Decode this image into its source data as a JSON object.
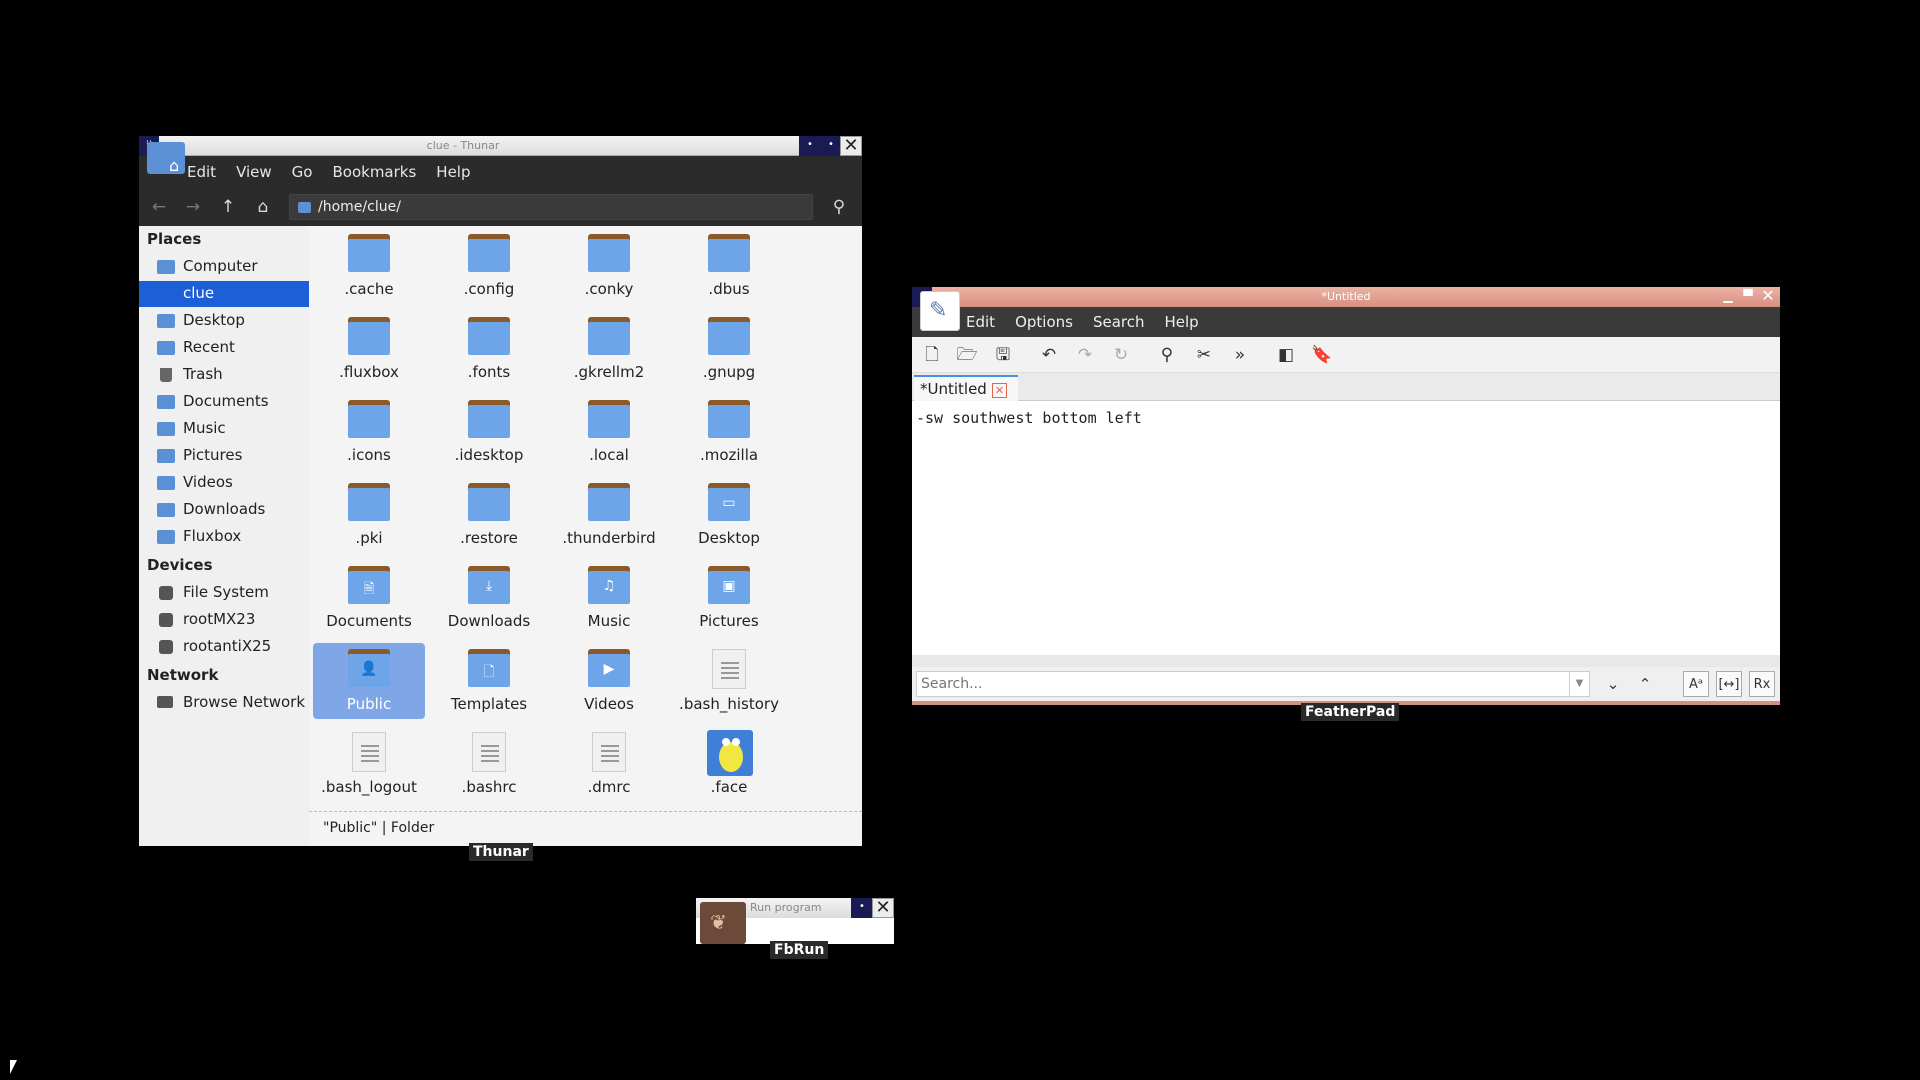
{
  "thunar": {
    "title": "clue - Thunar",
    "menu": [
      "Edit",
      "View",
      "Go",
      "Bookmarks",
      "Help"
    ],
    "location": "/home/clue/",
    "sidebar": {
      "places_header": "Places",
      "places": [
        "Computer",
        "clue",
        "Desktop",
        "Recent",
        "Trash",
        "Documents",
        "Music",
        "Pictures",
        "Videos",
        "Downloads",
        "Fluxbox"
      ],
      "selected": "clue",
      "devices_header": "Devices",
      "devices": [
        "File System",
        "rootMX23",
        "rootantiX25"
      ],
      "network_header": "Network",
      "network": [
        "Browse Network"
      ]
    },
    "files": [
      ".cache",
      ".config",
      ".conky",
      ".dbus",
      ".fluxbox",
      ".fonts",
      ".gkrellm2",
      ".gnupg",
      ".icons",
      ".idesktop",
      ".local",
      ".mozilla",
      ".pki",
      ".restore",
      ".thunderbird",
      "Desktop",
      "Documents",
      "Downloads",
      "Music",
      "Pictures",
      "Public",
      "Templates",
      "Videos",
      ".bash_history",
      ".bash_logout",
      ".bashrc",
      ".dmrc",
      ".face"
    ],
    "selected_file": "Public",
    "status": "\"Public\"  |  Folder",
    "taskbar_label": "Thunar"
  },
  "featherpad": {
    "title": "*Untitled",
    "menu": [
      "Edit",
      "Options",
      "Search",
      "Help"
    ],
    "tab_label": "*Untitled",
    "editor_text": "-sw southwest bottom left",
    "search_placeholder": "Search...",
    "taskbar_label": "FeatherPad"
  },
  "fbrun": {
    "title": "Run program",
    "taskbar_label": "FbRun"
  },
  "colors": {
    "selection": "#1d5fd6",
    "folder": "#6ea4e8",
    "featherpad_titlebar": "#d78f7f"
  }
}
